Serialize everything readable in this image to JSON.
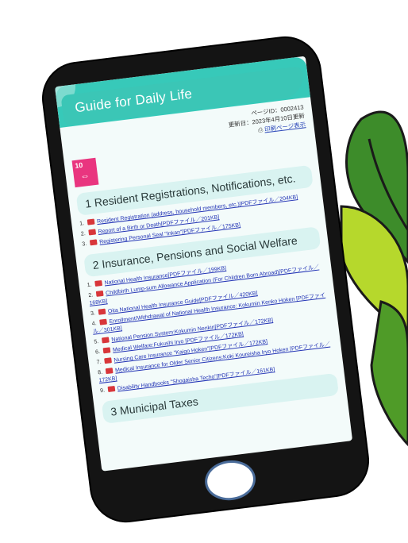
{
  "page": {
    "title": "Guide for Daily Life",
    "page_id": "ページID：0002413",
    "updated": "更新日：2023年4月10日更新",
    "print_label": "印刷ページ表示",
    "sdg_number": "10"
  },
  "sections": [
    {
      "heading": "1 Resident Registrations, Notifications, etc.",
      "items": [
        {
          "n": "1.",
          "text": "Resident Registration (address, household members, etc.)[PDFファイル／204KB]"
        },
        {
          "n": "2.",
          "text": "Report of a Birth or Death[PDFファイル／201KB]"
        },
        {
          "n": "3.",
          "text": "Registering Personal Seal \"Inkan\"[PDFファイル／175KB]"
        }
      ]
    },
    {
      "heading": "2 Insurance, Pensions and Social Welfare",
      "items": [
        {
          "n": "1.",
          "text": "National Health Insurance[PDFファイル／199KB]"
        },
        {
          "n": "2.",
          "text": "Childbirth Lump-sum Allowance Application (For Children Born Abroad)[PDFファイル／168KB]"
        },
        {
          "n": "3.",
          "text": "Oita National Health Insurance Guide[PDFファイル／420KB]"
        },
        {
          "n": "4.",
          "text": "Enrollment/Withdrawal of National Health Insurance: Kokumin Kenko Hoken [PDFファイル／301KB]"
        },
        {
          "n": "5.",
          "text": "National Pension System:Kokumin Nenkin[PDFファイル／172KB]"
        },
        {
          "n": "6.",
          "text": "Medical Welfare:Fukushi Iryo [PDFファイル／172KB]"
        },
        {
          "n": "7.",
          "text": "Nursing Care Insurance \"Kaigo Hoken\"[PDFファイル／172KB]"
        },
        {
          "n": "8.",
          "text": "Medical Insurance for Older Senior Citizens:Koki Koureisha Iryo Hoken [PDFファイル／172KB]"
        },
        {
          "n": "9.",
          "text": "Disability Handbooks \"Shogaisha Techo\"[PDFファイル／161KB]"
        }
      ]
    },
    {
      "heading": "3 Municipal Taxes",
      "items": []
    }
  ],
  "colors": {
    "header": "#37c9b9",
    "section_bg": "#d9f3f1",
    "link": "#2233b5",
    "pdf_icon": "#d8363a",
    "sdg": "#e9357f",
    "tablet": "#141414"
  }
}
